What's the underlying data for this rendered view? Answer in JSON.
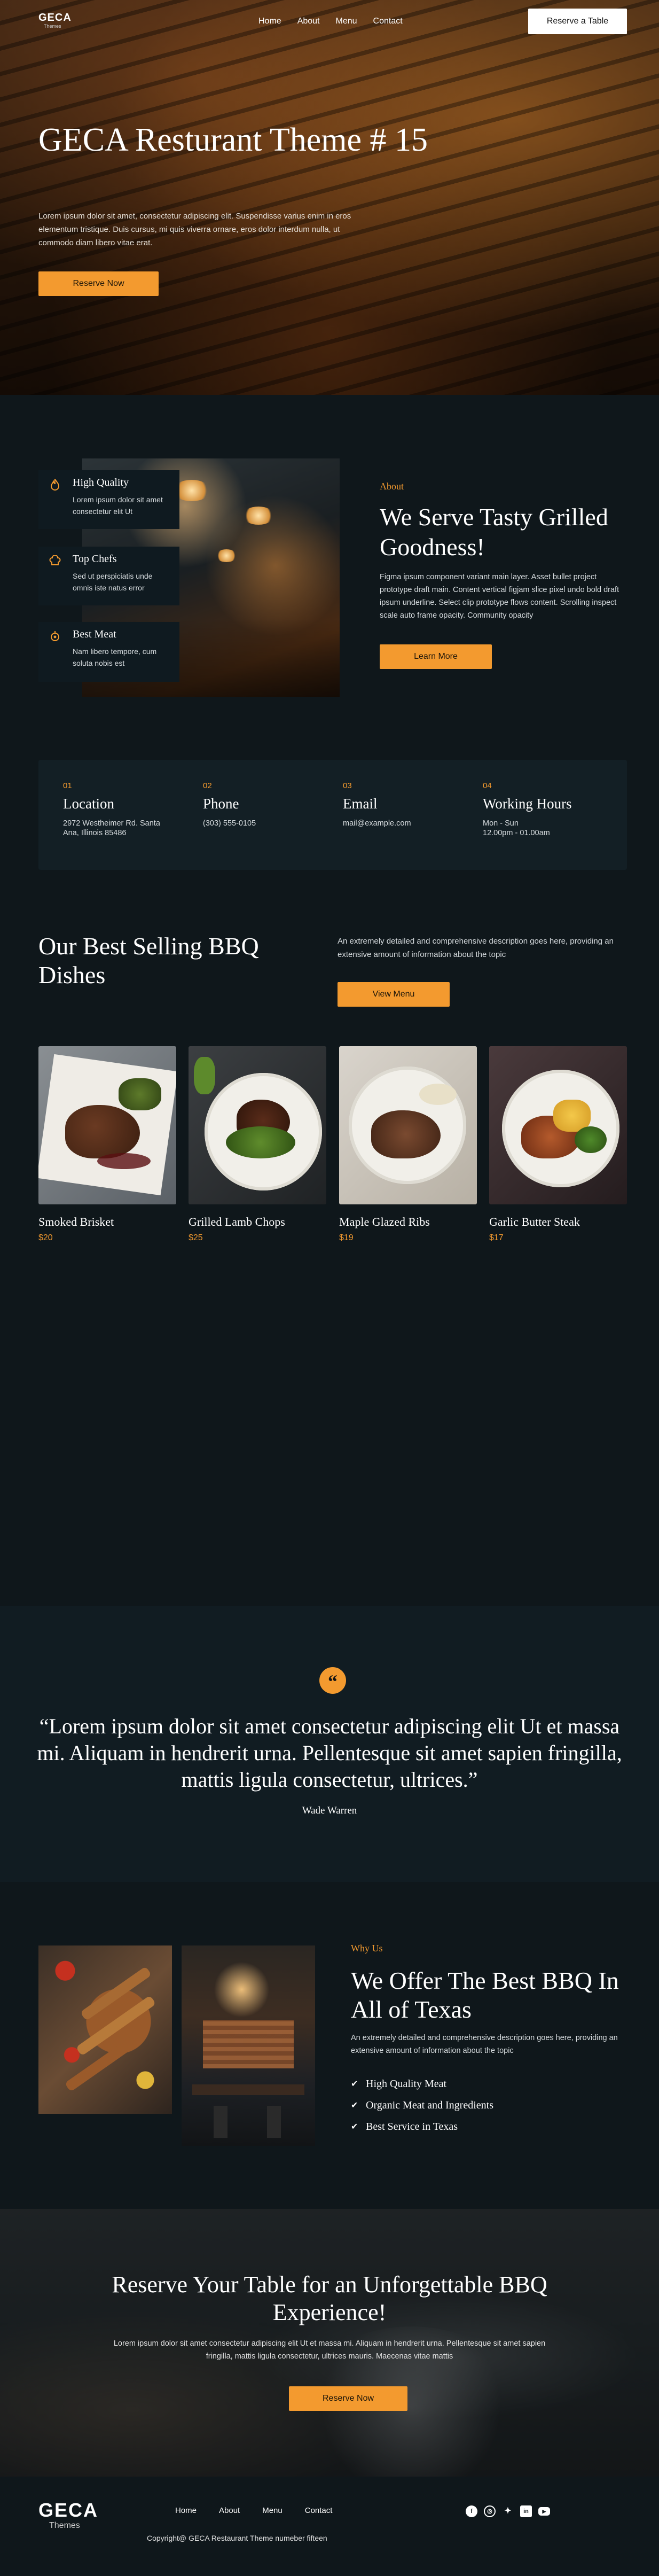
{
  "brand": {
    "name": "GECA",
    "sub": "Themes"
  },
  "nav": {
    "links": [
      "Home",
      "About",
      "Menu",
      "Contact"
    ],
    "cta": "Reserve a Table"
  },
  "hero": {
    "title": "GECA Resturant Theme # 15",
    "text": "Lorem ipsum dolor sit amet, consectetur adipiscing elit. Suspendisse varius enim in eros elementum tristique. Duis cursus, mi quis viverra ornare, eros dolor interdum nulla, ut commodo diam libero vitae erat.",
    "button": "Reserve Now"
  },
  "about": {
    "features": [
      {
        "icon": "flame-icon",
        "title": "High Quality",
        "text": "Lorem ipsum dolor sit amet consectetur elit Ut"
      },
      {
        "icon": "chef-hat-icon",
        "title": "Top Chefs",
        "text": "Sed ut perspiciatis unde omnis iste natus error"
      },
      {
        "icon": "meat-icon",
        "title": "Best Meat",
        "text": "Nam libero tempore, cum soluta nobis est"
      }
    ],
    "label": "About",
    "title": "We Serve Tasty Grilled Goodness!",
    "text": "Figma ipsum component variant main layer. Asset bullet project prototype draft main. Content vertical figjam slice pixel undo bold draft ipsum underline. Select clip prototype flows content. Scrolling inspect scale auto frame opacity. Community opacity",
    "button": "Learn More"
  },
  "info": [
    {
      "num": "01",
      "title": "Location",
      "body": "2972 Westheimer Rd. Santa\nAna, Illinois 85486"
    },
    {
      "num": "02",
      "title": "Phone",
      "body": "(303) 555-0105"
    },
    {
      "num": "03",
      "title": "Email",
      "body": "mail@example.com"
    },
    {
      "num": "04",
      "title": "Working Hours",
      "body": "Mon - Sun\n12.00pm - 01.00am"
    }
  ],
  "dishes": {
    "title": "Our Best Selling BBQ Dishes",
    "text": "An extremely detailed and comprehensive description goes here, providing an extensive amount of information about the topic",
    "button": "View Menu",
    "items": [
      {
        "name": "Smoked Brisket",
        "price": "$20"
      },
      {
        "name": "Grilled Lamb Chops",
        "price": "$25"
      },
      {
        "name": "Maple Glazed Ribs",
        "price": "$19"
      },
      {
        "name": "Garlic Butter Steak",
        "price": "$17"
      }
    ]
  },
  "testimonial": {
    "quote": "“Lorem ipsum dolor sit amet consectetur adipiscing elit Ut et massa mi. Aliquam in hendrerit urna. Pellentesque sit amet sapien fringilla, mattis ligula consectetur, ultrices.”",
    "author": "Wade Warren"
  },
  "why": {
    "label": "Why Us",
    "title": "We Offer The Best BBQ In All of Texas",
    "text": "An extremely detailed and comprehensive description goes here, providing an extensive amount of information about the topic",
    "items": [
      "High Quality Meat",
      "Organic Meat and Ingredients",
      "Best Service in Texas"
    ]
  },
  "cta": {
    "title": "Reserve Your Table for an Unforgettable BBQ Experience!",
    "text": "Lorem ipsum dolor sit amet consectetur adipiscing elit Ut et massa mi. Aliquam in hendrerit urna. Pellentesque sit amet sapien fringilla, mattis ligula consectetur, ultrices mauris. Maecenas vitae mattis",
    "button": "Reserve Now"
  },
  "footer": {
    "links": [
      "Home",
      "About",
      "Menu",
      "Contact"
    ],
    "copyright": "Copyright@ GECA Restaurant Theme numeber fifteen",
    "social": [
      "facebook-icon",
      "instagram-icon",
      "twitter-icon",
      "linkedin-icon",
      "youtube-icon"
    ]
  },
  "colors": {
    "accent": "#f39a2f",
    "background": "#0f171b",
    "card": "#131f25"
  }
}
